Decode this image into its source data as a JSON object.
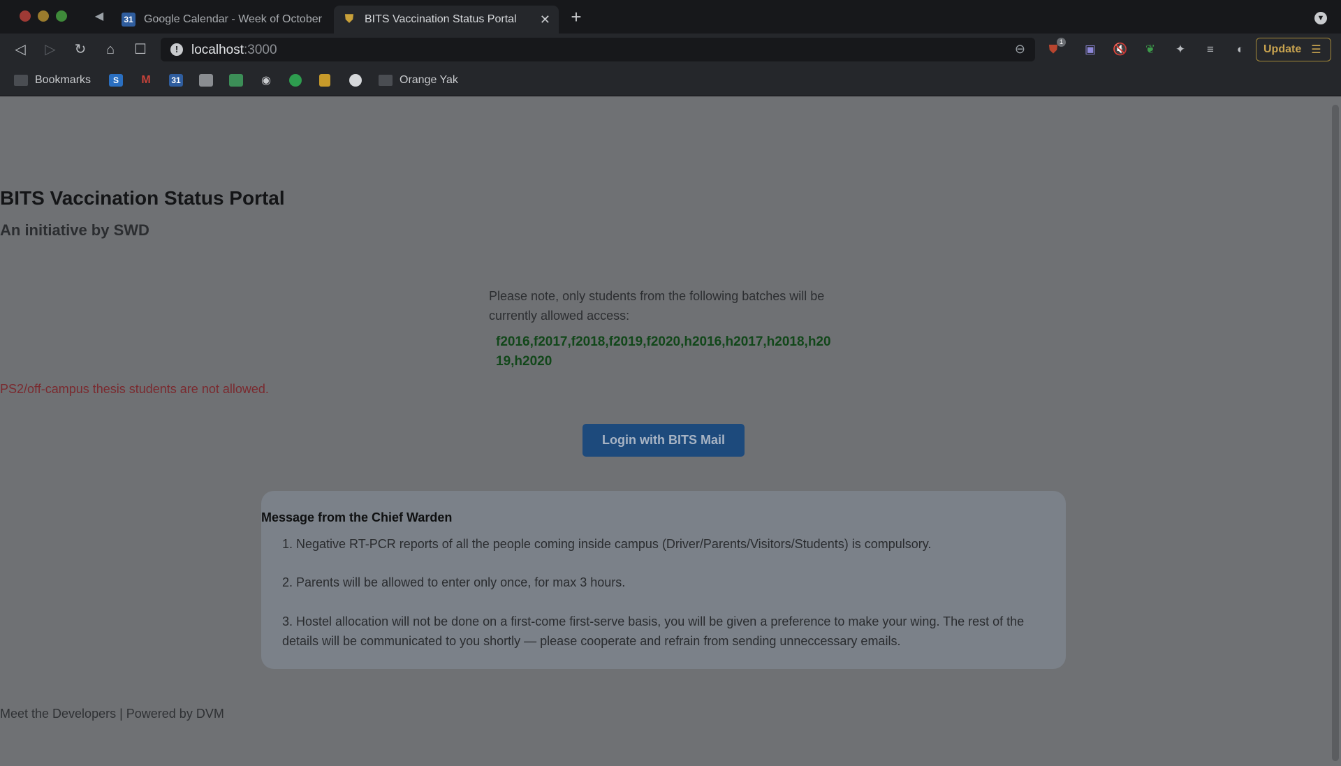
{
  "browser": {
    "tabs": [
      {
        "title": "Google Calendar - Week of October",
        "icon": "calendar-icon",
        "favicon_text": "31",
        "active": false
      },
      {
        "title": "BITS Vaccination Status Portal",
        "icon": "shield-icon",
        "active": true
      }
    ],
    "url_host": "localhost",
    "url_port": ":3000",
    "update_label": "Update",
    "extension_badge": "1",
    "bookmarks": {
      "folder_label": "Bookmarks",
      "s_icon_text": "S",
      "gmail_icon_text": "M",
      "calendar_icon_text": "31",
      "orange_yak_label": "Orange Yak"
    }
  },
  "page": {
    "title": "BITS Vaccination Status Portal",
    "subtitle": "An initiative by SWD",
    "note": "Please note, only students from the following batches will be currently allowed access:",
    "batches": "f2016,f2017,f2018,f2019,f2020,h2016,h2017,h2018,h2019,h2020",
    "warning": "PS2/off-campus thesis students are not allowed.",
    "login_label": "Login with BITS Mail",
    "warden": {
      "title": "Message from the Chief Warden",
      "items": [
        "1. Negative RT-PCR reports of all the people coming inside campus (Driver/Parents/Visitors/Students) is compulsory.",
        "2. Parents will be allowed to enter only once, for max 3 hours.",
        "3. Hostel allocation will not be done on a first-come first-serve basis, you will be given a preference to make your wing. The rest of the details will be communicated to you shortly — please cooperate and refrain from sending unneccessary emails."
      ]
    },
    "footer": "Meet the Developers | Powered by DVM"
  }
}
